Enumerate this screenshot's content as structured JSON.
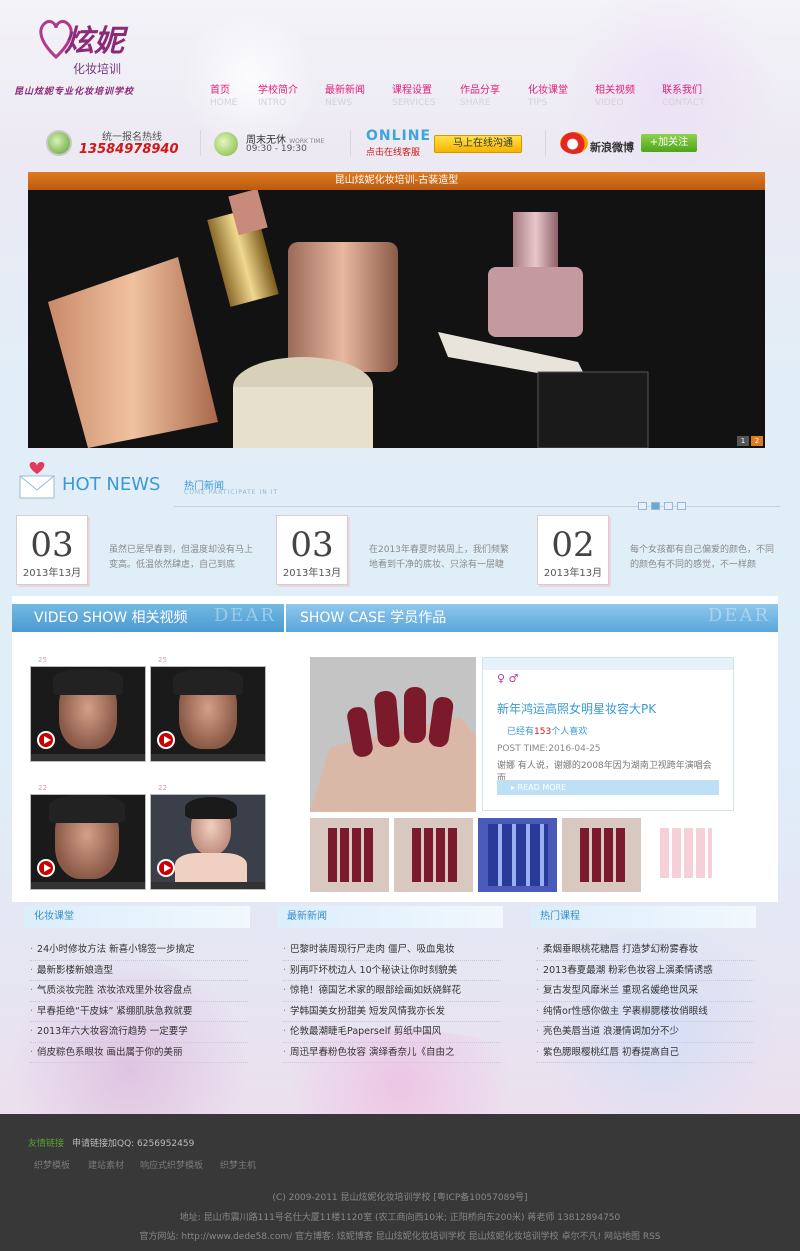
{
  "logo": {
    "title": "炫妮",
    "subtitle": "化妆培训",
    "slogan": "昆山炫妮专业化妆培训学校"
  },
  "nav": [
    {
      "cn": "首页",
      "en": "HOME"
    },
    {
      "cn": "学校简介",
      "en": "INTRO"
    },
    {
      "cn": "最新新闻",
      "en": "NEWS"
    },
    {
      "cn": "课程设置",
      "en": "SERVICES"
    },
    {
      "cn": "作品分享",
      "en": "SHARE"
    },
    {
      "cn": "化妆课堂",
      "en": "TIPS"
    },
    {
      "cn": "相关视频",
      "en": "VIDEO"
    },
    {
      "cn": "联系我们",
      "en": "CONTACT"
    }
  ],
  "contact": {
    "hotline_label": "统一报名热线",
    "hotline_number": "13584978940",
    "hours_label": "周末无休",
    "hours_label_en": "WORK TIME",
    "hours_time": "09:30 - 19:30",
    "online_logo": "ONLINE",
    "online_sub": "点击在线客服",
    "online_button": "马上在线沟通",
    "weibo_label": "新浪微博",
    "follow_button": "+加关注"
  },
  "banner": {
    "caption": "昆山炫妮化妆培训-古装造型",
    "pager": [
      "1",
      "2"
    ]
  },
  "hot_news": {
    "title": "HOT NEWS",
    "title_cn": "热门新闻",
    "title_en": "COME PARTICIPATE IN IT",
    "cards": [
      {
        "day": "03",
        "ym": "2013年13月",
        "snippet": "虽然已是早春到，但温度却没有马上变高。低温依然肆虐，自己到底"
      },
      {
        "day": "03",
        "ym": "2013年13月",
        "snippet": "在2013年春夏时装周上，我们频繁地看到千净的底妆、只涂有一层睫"
      },
      {
        "day": "02",
        "ym": "2013年13月",
        "snippet": "每个女孩都有自己偏爱的颜色，不同的颜色有不同的感觉，不一样颜"
      }
    ]
  },
  "video_show": {
    "title": "VIDEO SHOW 相关视频",
    "deco": "DEAR",
    "items": [
      {
        "num": "25"
      },
      {
        "num": "25"
      },
      {
        "num": "22"
      },
      {
        "num": "22"
      }
    ]
  },
  "show_case": {
    "title": "SHOW CASE 学员作品",
    "deco": "DEAR",
    "gender_icons": "♀ ♂",
    "item_title": "新年鸿运高照女明星妆容大PK",
    "likes_prefix": "已经有",
    "likes_count": "153",
    "likes_suffix": "个人喜欢",
    "post_time": "POST TIME:2016-04-25",
    "desc": "谢娜 有人说，谢娜的2008年因为湖南卫视跨年演唱会而",
    "read_more": "▸ READ MORE"
  },
  "columns": [
    {
      "title": "化妆课堂",
      "items": [
        "24小时修妆方法 新喜小锦签一步搞定",
        "最新影楼新娘造型",
        "气质淡妆完胜 浓妆浓戏里外妆容盘点",
        "早春拒绝“干皮妹” 紧绷肌肤急救就要",
        "2013年六大妆容流行趋势 一定要学",
        "俏皮粽色系眼妆 画出属于你的美丽"
      ]
    },
    {
      "title": "最新新闻",
      "items": [
        "巴黎时装周现行尸走肉 僵尸、吸血鬼妆",
        "别再吓坏枕边人 10个秘诀让你时刻貌美",
        "惊艳！德国艺术家的眼部绘画如妖娆鲜花",
        "学韩国美女扮甜美 短发风情我亦长发",
        "伦敦最潮睫毛Paperself 剪纸中国风",
        "周迅早春粉色妆容 演绎香奈儿《自由之"
      ]
    },
    {
      "title": "热门课程",
      "items": [
        "柔烟垂眼桃花糖唇 打造梦幻粉雾春妆",
        "2013春夏最潮 粉彩色妆容上演柔情诱惑",
        "复古发型风靡米兰 重现名媛绝世风采",
        "纯情or性感你做主 学裹柳腮楼妆俏眼线",
        "亮色美唇当道 浪漫情调加分不少",
        "紫色腮眼樱桃红唇 初春提高自己"
      ]
    }
  ],
  "footer": {
    "links_label": "友情链接",
    "links_apply": "申请链接加QQ: 6256952459",
    "links": [
      "织梦模板",
      "建站素材",
      "响应式织梦模板",
      "织梦主机"
    ],
    "copyright": "(C) 2009-2011 昆山炫妮化妆培训学校 [粤ICP备10057089号]",
    "address": "地址: 昆山市震川路111号名仕大厦11楼1120室 (农工商向西10米; 正阳桥向东200米)     蒋老师 13812894750",
    "sites": "官方网站: http://www.dede58.com/ 官方博客: 炫妮博客 昆山炫妮化妆培训学校 昆山炫妮化妆培训学校 卓尔不凡! 网站地图 RSS"
  },
  "colors": {
    "accent_pink": "#e0207a",
    "accent_blue": "#3a9ad6",
    "hotline_red": "#d01818",
    "footer_bg": "#383838"
  }
}
